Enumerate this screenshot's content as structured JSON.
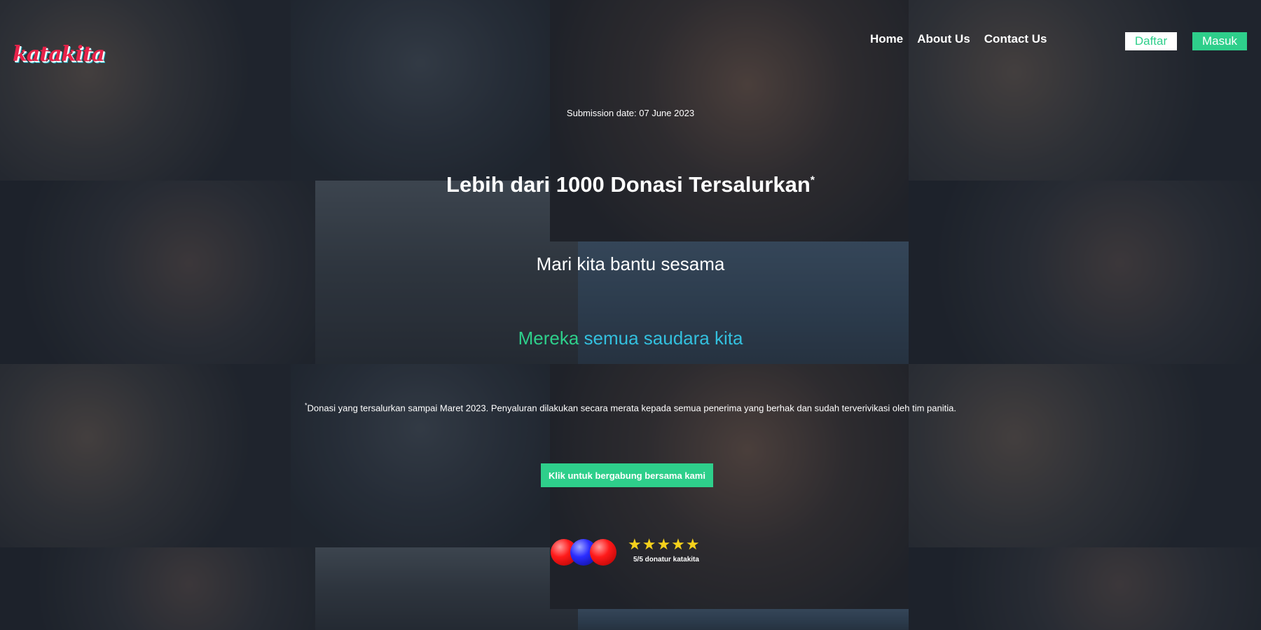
{
  "header": {
    "logo_text": "katakita",
    "nav": [
      {
        "label": "Home"
      },
      {
        "label": "About Us"
      },
      {
        "label": "Contact Us"
      }
    ],
    "daftar_label": "Daftar",
    "masuk_label": "Masuk"
  },
  "hero": {
    "submission_date": "Submission date: 07 June 2023",
    "headline": "Lebih dari 1000 Donasi Tersalurkan",
    "headline_mark": "*",
    "subhead": "Mari kita bantu sesama",
    "tagline_part1": "Mereka",
    "tagline_part2": "semua saudara kita",
    "footnote_mark": "*",
    "footnote": "Donasi yang tersalurkan sampai Maret 2023. Penyaluran dilakukan secara merata kepada semua penerima yang berhak dan sudah terverivikasi oleh tim panitia.",
    "cta_label": "Klik untuk bergabung bersama kami"
  },
  "rating": {
    "avatars": [
      "red",
      "blue",
      "red"
    ],
    "stars": "★★★★★",
    "stars_value": 5,
    "stars_max": 5,
    "text": "5/5 donatur katakita"
  },
  "colors": {
    "accent_green": "#2ecf8b",
    "accent_blue": "#33c0de",
    "star_yellow": "#f5d11c",
    "logo_red": "#e8224a"
  }
}
